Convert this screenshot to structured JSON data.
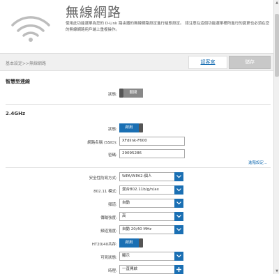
{
  "header": {
    "title": "無線網路",
    "description": "使用此功能選單為您的 D-Link 路由器的無線網路設定進行組態設定。 請注意在這個功能選單裡所進行的變更也必須在您的無線網路用戶端上重複操作。"
  },
  "toolbar": {
    "breadcrumb": "基本設定>>無線網路",
    "help_label": "認客宮",
    "save_label": "儲存"
  },
  "smart_connect": {
    "title": "智慧型連線",
    "status_label": "狀態:",
    "toggle_label": "關閉"
  },
  "band24": {
    "title": "2.4GHz",
    "status_label": "狀態:",
    "toggle_label": "啟用",
    "ssid_label": "網路名稱 (SSID):",
    "ssid_value": "XFdlink-F600",
    "password_label": "密碼:",
    "password_value": "29095286",
    "advanced_label": "進階設定..."
  },
  "advanced": {
    "security_label": "安全性防寫方式:",
    "security_value": "WPA/WPA2-個人",
    "mode_label": "802.11 模式:",
    "mode_value": "混合802.11b/g/n/ax",
    "channel_label": "頻道:",
    "channel_value": "自動",
    "power_label": "傳輸強度:",
    "power_value": "高",
    "width_label": "頻道寬度:",
    "width_value": "自動 20/40 MHz",
    "ht_label": "HT20/40共存:",
    "ht_toggle_label": "啟用",
    "visibility_label": "可見狀態:",
    "visibility_value": "顯示",
    "schedule_label": "時程:",
    "schedule_value": "一直開啟"
  },
  "colors": {
    "accent": "#1a6fb3",
    "toggle_off": "#888888"
  }
}
